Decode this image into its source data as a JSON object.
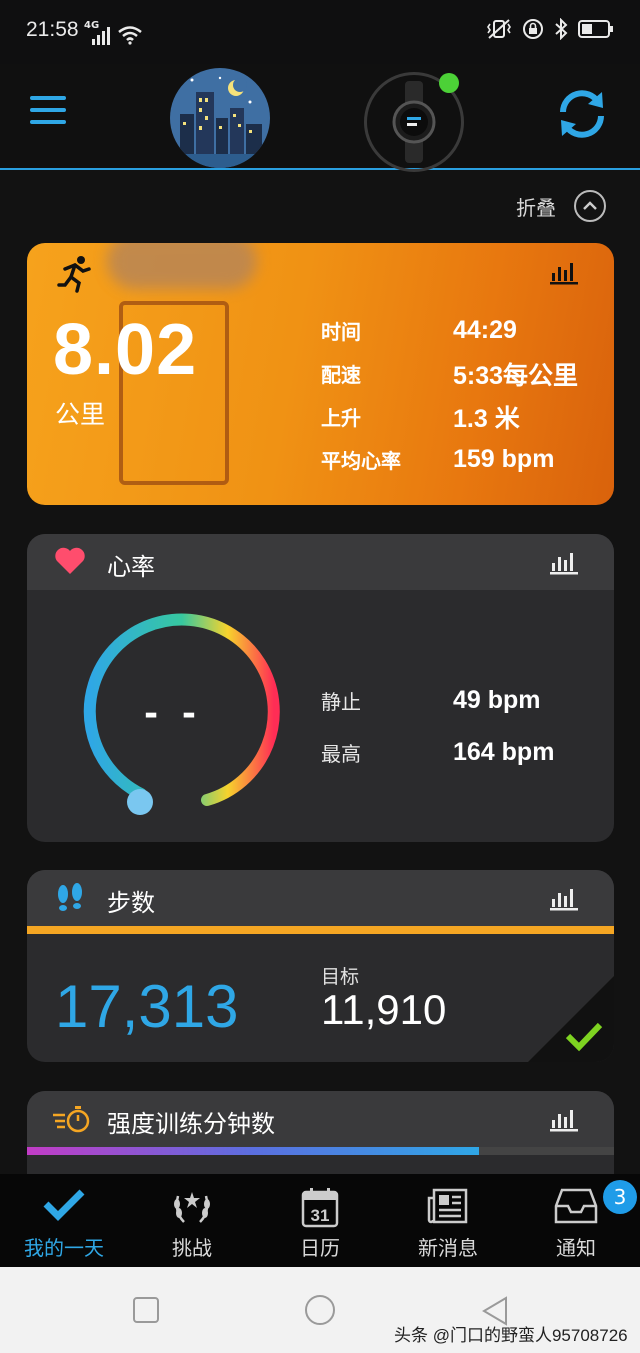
{
  "status_bar": {
    "time": "21:58",
    "network": "4G",
    "icons": [
      "signal-icon",
      "wifi-icon",
      "vibrate-icon",
      "lock-icon",
      "bluetooth-icon",
      "battery-icon"
    ]
  },
  "header": {
    "menu_icon": "menu-icon",
    "avatar": "avatar-night-city",
    "device_status_color": "#4cd137",
    "sync_icon": "sync-icon",
    "accent": "#2fa7e6"
  },
  "collapse": {
    "label": "折叠"
  },
  "activity": {
    "distance": "8.02",
    "unit": "公里",
    "stats": [
      {
        "label": "时间",
        "value": "44:29"
      },
      {
        "label": "配速",
        "value": "5:33每公里"
      },
      {
        "label": "上升",
        "value": "1.3 米"
      },
      {
        "label": "平均心率",
        "value": "159 bpm"
      }
    ]
  },
  "heart_rate": {
    "title": "心率",
    "current": "- -",
    "rows": [
      {
        "label": "静止",
        "value": "49 bpm"
      },
      {
        "label": "最高",
        "value": "164 bpm"
      }
    ]
  },
  "steps": {
    "title": "步数",
    "value": "17,313",
    "goal_label": "目标",
    "goal_value": "11,910",
    "bar_color": "#f5a623"
  },
  "intensity": {
    "title": "强度训练分钟数",
    "progress": 0.77
  },
  "bottom_nav": {
    "items": [
      {
        "label": "我的一天",
        "icon": "check-icon"
      },
      {
        "label": "挑战",
        "icon": "laurel-icon"
      },
      {
        "label": "日历",
        "icon": "calendar-icon",
        "icon_text": "31"
      },
      {
        "label": "新消息",
        "icon": "newsfeed-icon"
      },
      {
        "label": "通知",
        "icon": "inbox-icon"
      }
    ],
    "badge": "3"
  },
  "watermark": "头条 @门口的野蛮人95708726"
}
